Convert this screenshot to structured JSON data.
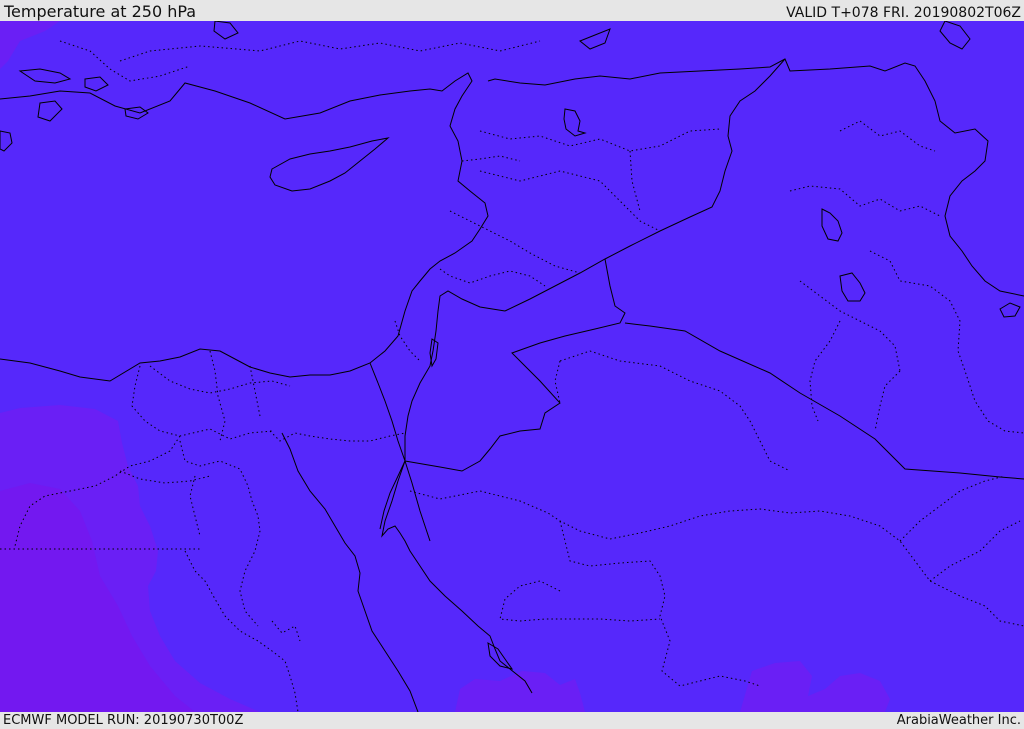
{
  "header": {
    "title": "Temperature at 250 hPa",
    "valid": "VALID T+078 FRI. 20190802T06Z"
  },
  "footer": {
    "model_run": "ECMWF MODEL RUN: 20190730T00Z",
    "credit": "ArabiaWeather Inc."
  },
  "map": {
    "fill_main": "#5628fb",
    "fill_warm": "#6a1ff5",
    "fill_warmer": "#7318f0",
    "border_color": "#000000"
  }
}
